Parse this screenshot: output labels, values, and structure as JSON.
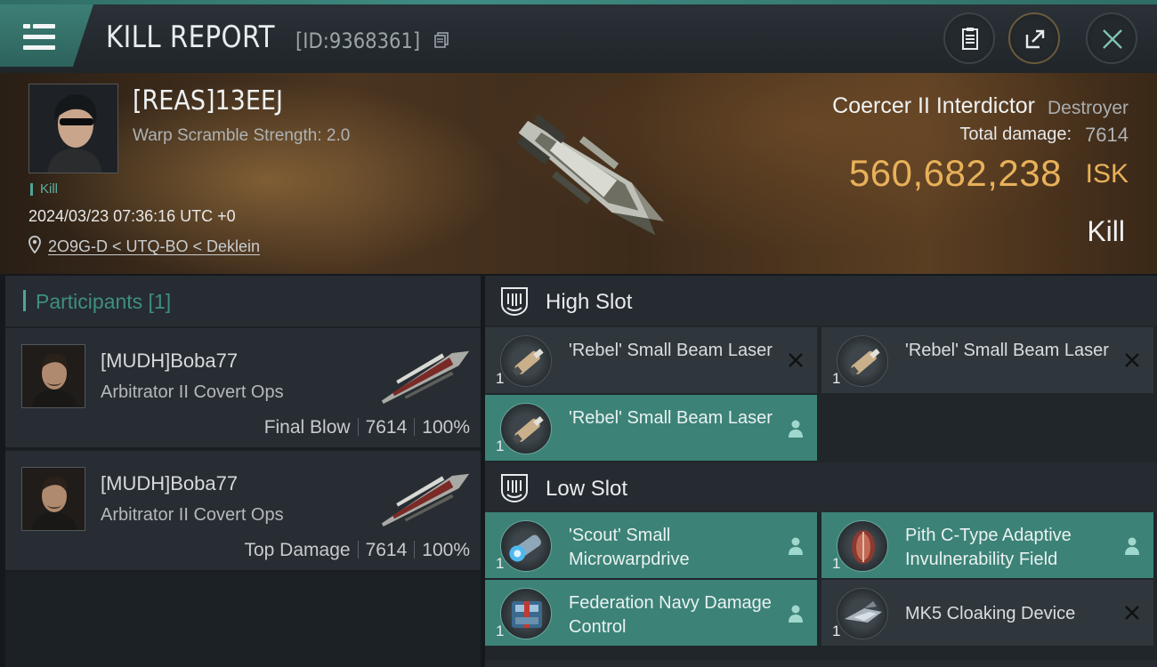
{
  "header": {
    "title": "KILL REPORT",
    "report_id": "[ID:9368361]",
    "icons": [
      "menu-icon",
      "copy-icon",
      "clipboard-icon",
      "share-icon",
      "close-icon"
    ]
  },
  "victim": {
    "name": "[REAS]13EEJ",
    "warp_scramble": "Warp Scramble Strength: 2.0",
    "tag": "Kill",
    "datetime": "2024/03/23 07:36:16 UTC +0",
    "location": "2O9G-D < UTQ-BO < Deklein",
    "ship_name": "Coercer II Interdictor",
    "ship_class": "Destroyer",
    "total_damage_label": "Total damage:",
    "total_damage": "7614",
    "isk_value": "560,682,238",
    "isk_unit": "ISK",
    "result": "Kill"
  },
  "participants": {
    "title": "Participants [1]",
    "rows": [
      {
        "name": "[MUDH]Boba77",
        "ship": "Arbitrator II Covert Ops",
        "role": "Final Blow",
        "damage": "7614",
        "percent": "100%"
      },
      {
        "name": "[MUDH]Boba77",
        "ship": "Arbitrator II Covert Ops",
        "role": "Top Damage",
        "damage": "7614",
        "percent": "100%"
      }
    ]
  },
  "slots": {
    "high": {
      "title": "High Slot",
      "items": [
        {
          "name": "'Rebel' Small Beam Laser",
          "qty": "1",
          "state": "destroyed"
        },
        {
          "name": "'Rebel' Small Beam Laser",
          "qty": "1",
          "state": "destroyed"
        },
        {
          "name": "'Rebel' Small Beam Laser",
          "qty": "1",
          "state": "dropped"
        }
      ]
    },
    "low": {
      "title": "Low Slot",
      "items": [
        {
          "name": "'Scout' Small Microwarpdrive",
          "qty": "1",
          "state": "dropped"
        },
        {
          "name": "Pith C-Type Adaptive Invulnerability Field",
          "qty": "1",
          "state": "dropped"
        },
        {
          "name": "Federation Navy Damage Control",
          "qty": "1",
          "state": "dropped"
        },
        {
          "name": "MK5 Cloaking Device",
          "qty": "1",
          "state": "destroyed"
        }
      ]
    }
  },
  "colors": {
    "accent_teal": "#3c8277",
    "isk_gold": "#e8b15a",
    "panel_dark": "#272d32"
  }
}
